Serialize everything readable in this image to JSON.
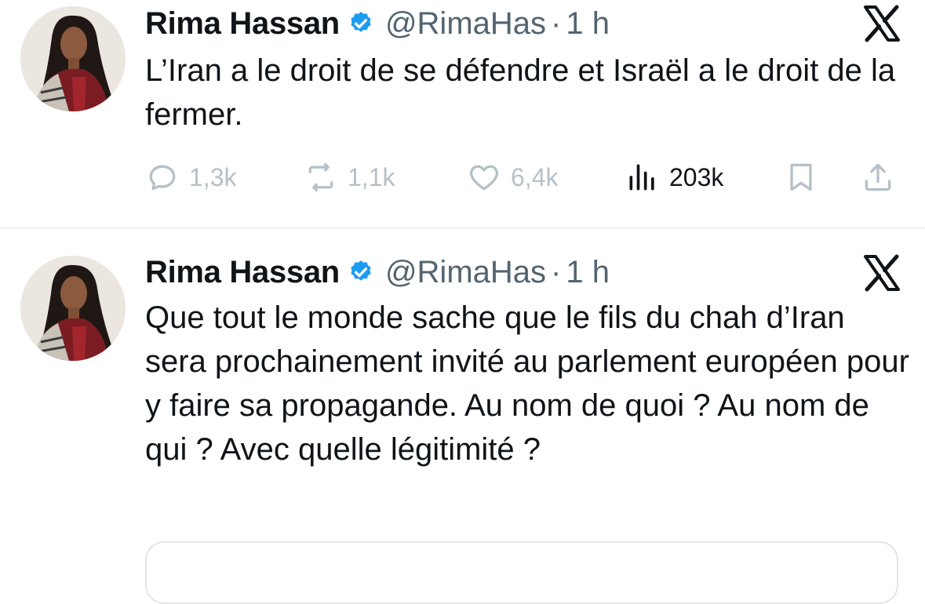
{
  "tweets": [
    {
      "author_name": "Rima Hassan",
      "handle": "@RimaHas",
      "separator": "·",
      "time": "1 h",
      "text": "L’Iran a le droit de se défendre et Israël a le droit de la fermer.",
      "stats": {
        "replies": "1,3k",
        "reposts": "1,1k",
        "likes": "6,4k",
        "views": "203k"
      }
    },
    {
      "author_name": "Rima Hassan",
      "handle": "@RimaHas",
      "separator": "·",
      "time": "1 h",
      "text": "Que tout le monde sache que le fils du chah d’Iran sera prochainement invité au parlement européen pour y faire sa propagande. Au nom de quoi ? Au nom de qui ? Avec quelle légitimité ?"
    }
  ],
  "icons": {
    "verified": "verified-badge-icon",
    "platform": "x-logo-icon",
    "reply": "reply-icon",
    "repost": "repost-icon",
    "like": "heart-icon",
    "views": "views-icon",
    "bookmark": "bookmark-icon",
    "share": "share-icon"
  },
  "colors": {
    "verified_blue": "#1d9bf0",
    "text": "#0f1419",
    "secondary": "#536471",
    "inactive_icon": "#b6c0c7"
  }
}
